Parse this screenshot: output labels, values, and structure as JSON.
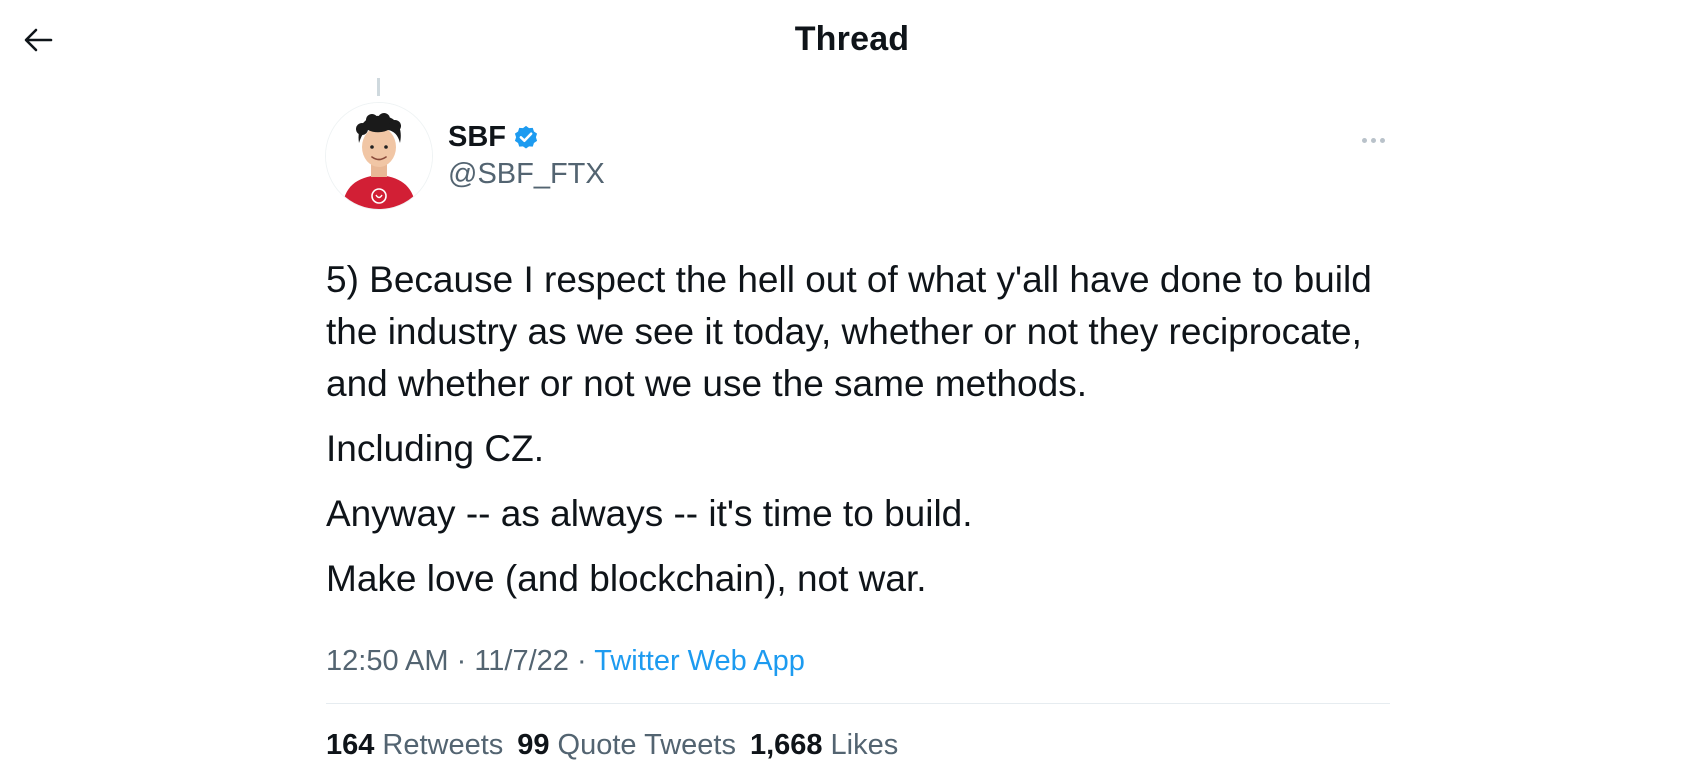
{
  "header": {
    "title": "Thread",
    "back_icon": "arrow-left-icon"
  },
  "tweet": {
    "author": {
      "display_name": "SBF",
      "handle": "@SBF_FTX",
      "verified": true
    },
    "paragraphs": [
      "5) Because I respect the hell out of what y'all have done to build the industry as we see it today, whether or not they reciprocate, and whether or not we use the same methods.",
      "Including CZ.",
      "Anyway -- as always -- it's time to build.",
      "Make love (and blockchain), not war."
    ],
    "meta": {
      "time": "12:50 AM",
      "separator": "·",
      "date": "11/7/22",
      "source": "Twitter Web App"
    },
    "stats": {
      "retweets_count": "164",
      "retweets_label": "Retweets",
      "quotes_count": "99",
      "quotes_label": "Quote Tweets",
      "likes_count": "1,668",
      "likes_label": "Likes"
    }
  },
  "colors": {
    "accent": "#1d9bf0",
    "text_primary": "#0f1419",
    "text_secondary": "#536471",
    "verified": "#1d9bf0",
    "avatar_shirt": "#d21f35"
  }
}
